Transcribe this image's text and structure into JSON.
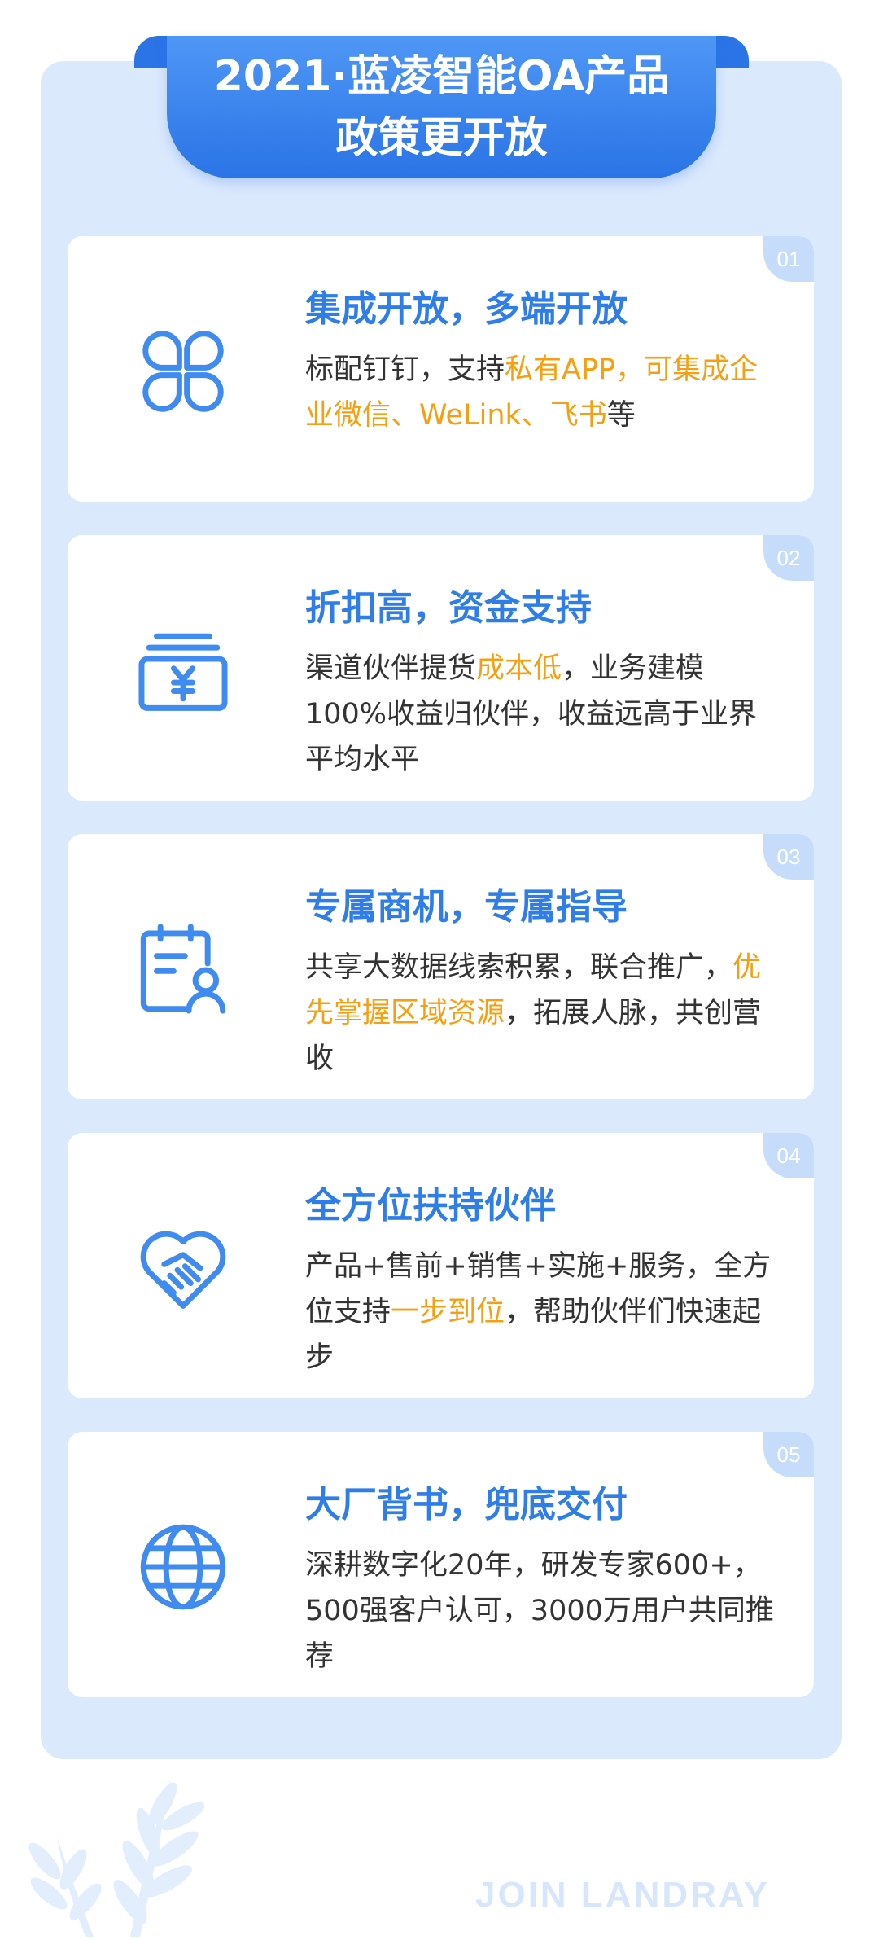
{
  "header": {
    "line1": "2021·蓝凌智能OA产品",
    "line2": "政策更开放"
  },
  "cards": [
    {
      "number": "01",
      "icon": "clover-icon",
      "title": "集成开放，多端开放",
      "desc": [
        "标配钉钉，支持",
        "私有APP，可集成企业微信、WeLink、飞书",
        "等"
      ]
    },
    {
      "number": "02",
      "icon": "yen-cash-icon",
      "title": "折扣高，资金支持",
      "desc": [
        "渠道伙伴提货",
        "成本低",
        "，业务建模100%收益归伙伴，收益远高于业界平均水平"
      ]
    },
    {
      "number": "03",
      "icon": "clipboard-user-icon",
      "title": "专属商机，专属指导",
      "desc": [
        "共享大数据线索积累，联合推广，",
        "优先掌握区域资源",
        "，拓展人脉，共创营收"
      ]
    },
    {
      "number": "04",
      "icon": "heart-handshake-icon",
      "title": "全方位扶持伙伴",
      "desc": [
        "产品+售前+销售+实施+服务，全方位支持",
        "一步到位",
        "，帮助伙伴们快速起步"
      ]
    },
    {
      "number": "05",
      "icon": "globe-icon",
      "title": "大厂背书，兜底交付",
      "desc": [
        "深耕数字化20年，研发专家600+，500强客户认可，3000万用户共同推荐",
        "",
        ""
      ]
    }
  ],
  "footer": {
    "brand": "JOIN LANDRAY"
  },
  "colors": {
    "accent": "#2f7ee8",
    "highlight": "#f5a012",
    "panel": "#dbe9fd"
  }
}
